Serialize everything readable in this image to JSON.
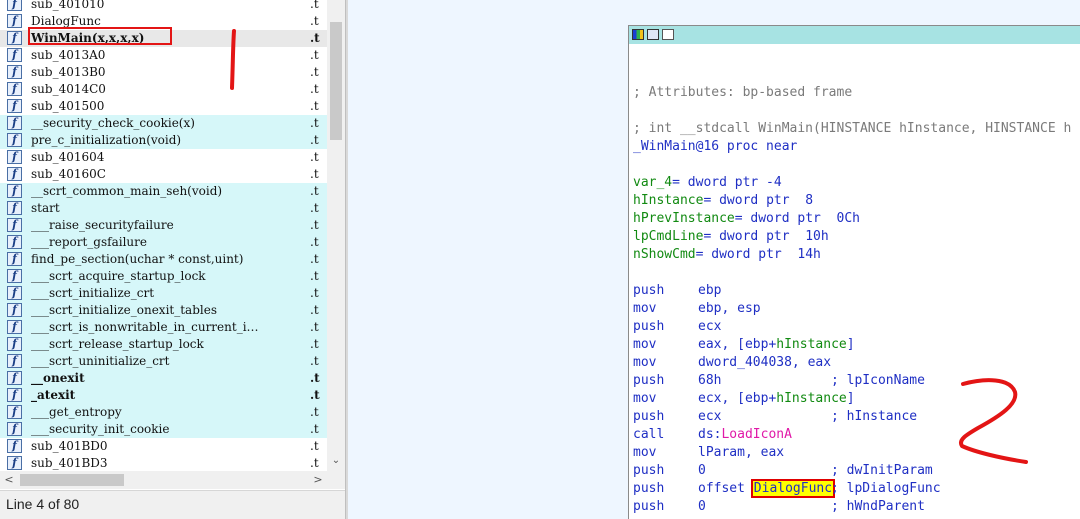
{
  "functions": [
    {
      "name": "sub_401010",
      "segment": ".t",
      "style": "normal"
    },
    {
      "name": "DialogFunc",
      "segment": ".t",
      "style": "normal"
    },
    {
      "name": "WinMain(x,x,x,x)",
      "segment": ".t",
      "style": "selected"
    },
    {
      "name": "sub_4013A0",
      "segment": ".t",
      "style": "normal"
    },
    {
      "name": "sub_4013B0",
      "segment": ".t",
      "style": "normal"
    },
    {
      "name": "sub_4014C0",
      "segment": ".t",
      "style": "normal"
    },
    {
      "name": "sub_401500",
      "segment": ".t",
      "style": "normal"
    },
    {
      "name": "__security_check_cookie(x)",
      "segment": ".t",
      "style": "lib"
    },
    {
      "name": "pre_c_initialization(void)",
      "segment": ".t",
      "style": "lib"
    },
    {
      "name": "sub_401604",
      "segment": ".t",
      "style": "normal"
    },
    {
      "name": "sub_40160C",
      "segment": ".t",
      "style": "normal"
    },
    {
      "name": "__scrt_common_main_seh(void)",
      "segment": ".t",
      "style": "lib"
    },
    {
      "name": "start",
      "segment": ".t",
      "style": "lib"
    },
    {
      "name": "___raise_securityfailure",
      "segment": ".t",
      "style": "lib"
    },
    {
      "name": "___report_gsfailure",
      "segment": ".t",
      "style": "lib"
    },
    {
      "name": "find_pe_section(uchar * const,uint)",
      "segment": ".t",
      "style": "lib"
    },
    {
      "name": "___scrt_acquire_startup_lock",
      "segment": ".t",
      "style": "lib"
    },
    {
      "name": "___scrt_initialize_crt",
      "segment": ".t",
      "style": "lib"
    },
    {
      "name": "___scrt_initialize_onexit_tables",
      "segment": ".t",
      "style": "lib"
    },
    {
      "name": "___scrt_is_nonwritable_in_current_i…",
      "segment": ".t",
      "style": "lib"
    },
    {
      "name": "___scrt_release_startup_lock",
      "segment": ".t",
      "style": "lib"
    },
    {
      "name": "___scrt_uninitialize_crt",
      "segment": ".t",
      "style": "lib"
    },
    {
      "name": "__onexit",
      "segment": ".t",
      "style": "libbold"
    },
    {
      "name": "_atexit",
      "segment": ".t",
      "style": "libbold"
    },
    {
      "name": "___get_entropy",
      "segment": ".t",
      "style": "lib"
    },
    {
      "name": "___security_init_cookie",
      "segment": ".t",
      "style": "lib"
    },
    {
      "name": "sub_401BD0",
      "segment": ".t",
      "style": "normal"
    },
    {
      "name": "sub_401BD3",
      "segment": ".t",
      "style": "normal"
    }
  ],
  "function_icon_glyph": "f",
  "scroll": {
    "left": "<",
    "right": ">",
    "down": "⌄"
  },
  "status": "Line 4 of 80",
  "disasm": {
    "comment_attr": "; Attributes: bp-based frame",
    "proto": "; int __stdcall WinMain(HINSTANCE hInstance, HINSTANCE h",
    "proc": "_WinMain@16 proc near",
    "vars": [
      {
        "name": "var_4",
        "def": "= dword ptr -4"
      },
      {
        "name": "hInstance",
        "def": "= dword ptr  8"
      },
      {
        "name": "hPrevInstance",
        "def": "= dword ptr  0Ch"
      },
      {
        "name": "lpCmdLine",
        "def": "= dword ptr  10h"
      },
      {
        "name": "nShowCmd",
        "def": "= dword ptr  14h"
      }
    ],
    "lines": [
      {
        "m": "push",
        "pre": "ebp",
        "arg": "",
        "post": "",
        "c": ""
      },
      {
        "m": "mov",
        "pre": "ebp, esp",
        "arg": "",
        "post": "",
        "c": ""
      },
      {
        "m": "push",
        "pre": "ecx",
        "arg": "",
        "post": "",
        "c": ""
      },
      {
        "m": "mov",
        "pre": "eax, [ebp+",
        "arg": "hInstance",
        "post": "]",
        "c": ""
      },
      {
        "m": "mov",
        "pre": "dword_404038, eax",
        "arg": "",
        "post": "",
        "c": ""
      },
      {
        "m": "push",
        "pre": "68h",
        "arg": "",
        "post": "",
        "c": "; lpIconName"
      },
      {
        "m": "mov",
        "pre": "ecx, [ebp+",
        "arg": "hInstance",
        "post": "]",
        "c": ""
      },
      {
        "m": "push",
        "pre": "ecx",
        "arg": "",
        "post": "",
        "c": "; hInstance"
      },
      {
        "m": "call",
        "pre": "ds:",
        "arg": "LoadIconA",
        "post": "",
        "c": ""
      },
      {
        "m": "mov",
        "pre": "lParam, eax",
        "arg": "",
        "post": "",
        "c": ""
      },
      {
        "m": "push",
        "pre": "0",
        "arg": "",
        "post": "",
        "c": "; dwInitParam"
      },
      {
        "m": "push",
        "pre": "offset ",
        "arg": "DialogFunc",
        "post": "",
        "c": "; lpDialogFunc"
      },
      {
        "m": "push",
        "pre": "0",
        "arg": "",
        "post": "",
        "c": "; hWndParent"
      }
    ]
  },
  "annotations": {
    "mark1": "1",
    "mark2": "2",
    "color": "#e31515"
  },
  "colors": {
    "lib_bg": "#d6f7f9",
    "title_bar": "#a7e3e3",
    "graph_bg": "#eef6ff",
    "code_blue": "#1f2fc4",
    "code_green": "#128a12",
    "import_pink": "#e01aa8"
  }
}
